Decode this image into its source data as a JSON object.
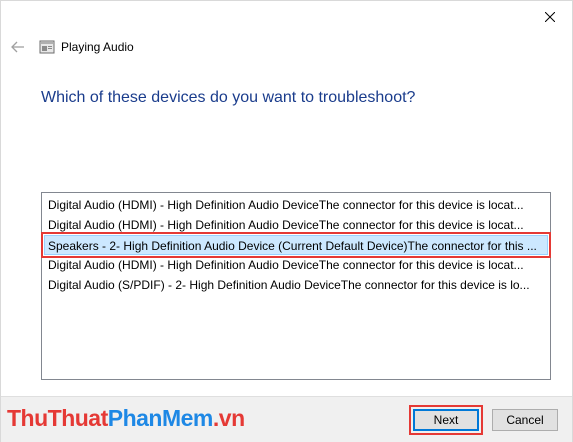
{
  "window": {
    "title": "Playing Audio",
    "close_label": "Close",
    "back_label": "Back"
  },
  "heading": "Which of these devices do you want to troubleshoot?",
  "devices": [
    {
      "label": "Digital Audio (HDMI) - High Definition Audio DeviceThe connector for this device is locat...",
      "selected": false
    },
    {
      "label": "Digital Audio (HDMI) - High Definition Audio DeviceThe connector for this device is locat...",
      "selected": false
    },
    {
      "label": "Speakers - 2- High Definition Audio Device (Current Default Device)The connector for this ...",
      "selected": true
    },
    {
      "label": "Digital Audio (HDMI) - High Definition Audio DeviceThe connector for this device is locat...",
      "selected": false
    },
    {
      "label": "Digital Audio (S/PDIF) - 2- High Definition Audio DeviceThe connector for this device is lo...",
      "selected": false
    }
  ],
  "buttons": {
    "next": "Next",
    "cancel": "Cancel"
  },
  "watermark": {
    "part1": "ThuThuat",
    "part2": "PhanMem",
    "part3": ".vn"
  },
  "colors": {
    "heading": "#1a3c8c",
    "selection": "#cce8ff",
    "highlight_box": "#e53935",
    "primary_button_border": "#0078d7"
  }
}
